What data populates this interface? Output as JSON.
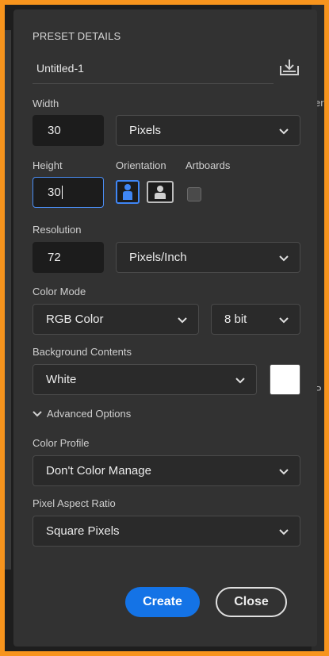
{
  "preset": {
    "section_title": "PRESET DETAILS",
    "name": "Untitled-1",
    "save_icon": "save-preset-icon"
  },
  "width": {
    "label": "Width",
    "value": "30",
    "unit": "Pixels"
  },
  "height": {
    "label": "Height",
    "value": "30"
  },
  "orientation": {
    "label": "Orientation",
    "selected": "portrait",
    "options": [
      "portrait",
      "landscape"
    ]
  },
  "artboards": {
    "label": "Artboards",
    "checked": false
  },
  "resolution": {
    "label": "Resolution",
    "value": "72",
    "unit": "Pixels/Inch"
  },
  "color_mode": {
    "label": "Color Mode",
    "mode": "RGB Color",
    "depth": "8 bit"
  },
  "background": {
    "label": "Background Contents",
    "value": "White",
    "swatch_color": "#ffffff"
  },
  "advanced": {
    "label": "Advanced Options",
    "expanded": true
  },
  "color_profile": {
    "label": "Color Profile",
    "value": "Don't Color Manage"
  },
  "pixel_aspect": {
    "label": "Pixel Aspect Ratio",
    "value": "Square Pixels"
  },
  "actions": {
    "create_label": "Create",
    "close_label": "Close",
    "accent_color": "#1473e6"
  },
  "side_fragments": [
    "er",
    "P"
  ]
}
